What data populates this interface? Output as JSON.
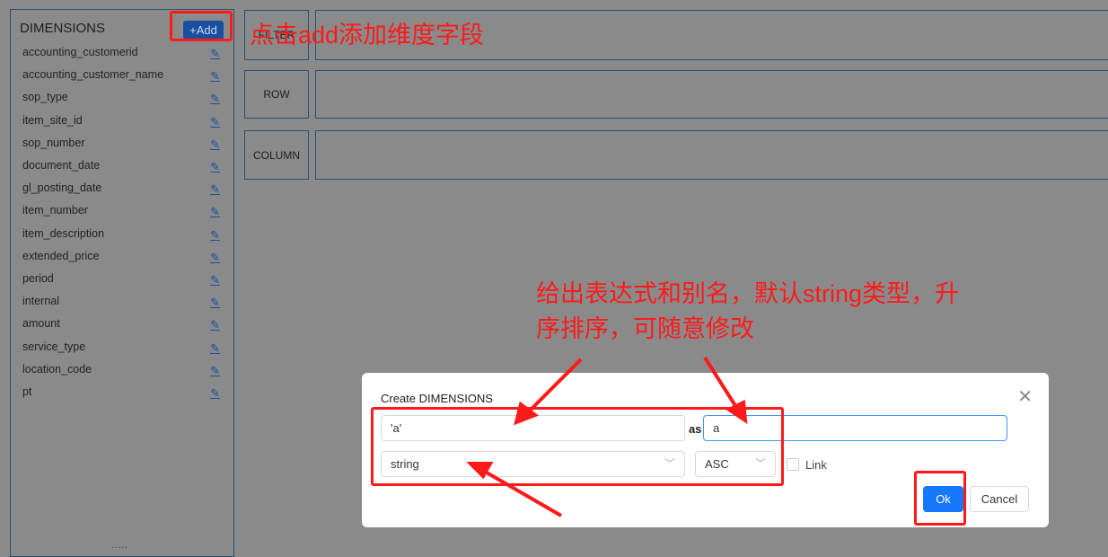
{
  "sidebar": {
    "title": "DIMENSIONS",
    "add_label": "+Add",
    "edit_icon": "pencil-icon",
    "items": [
      "accounting_customerid",
      "accounting_customer_name",
      "sop_type",
      "item_site_id",
      "sop_number",
      "document_date",
      "gl_posting_date",
      "item_number",
      "item_description",
      "extended_price",
      "period",
      "internal",
      "amount",
      "service_type",
      "location_code",
      "pt"
    ],
    "resize_handle": "....."
  },
  "zones": {
    "filter": "FILTER",
    "row": "ROW",
    "column": "COLUMN"
  },
  "annotations": {
    "top": "点击add添加维度字段",
    "middle_line1": "给出表达式和别名，默认string类型，升",
    "middle_line2": "序排序，可随意修改",
    "color": "#ff1a1a"
  },
  "modal": {
    "title": "Create DIMENSIONS",
    "expression": "'a'",
    "as_label": "as",
    "alias": "a",
    "type": "string",
    "order": "ASC",
    "link_label": "Link",
    "ok_label": "Ok",
    "cancel_label": "Cancel",
    "close_icon": "close-icon"
  }
}
